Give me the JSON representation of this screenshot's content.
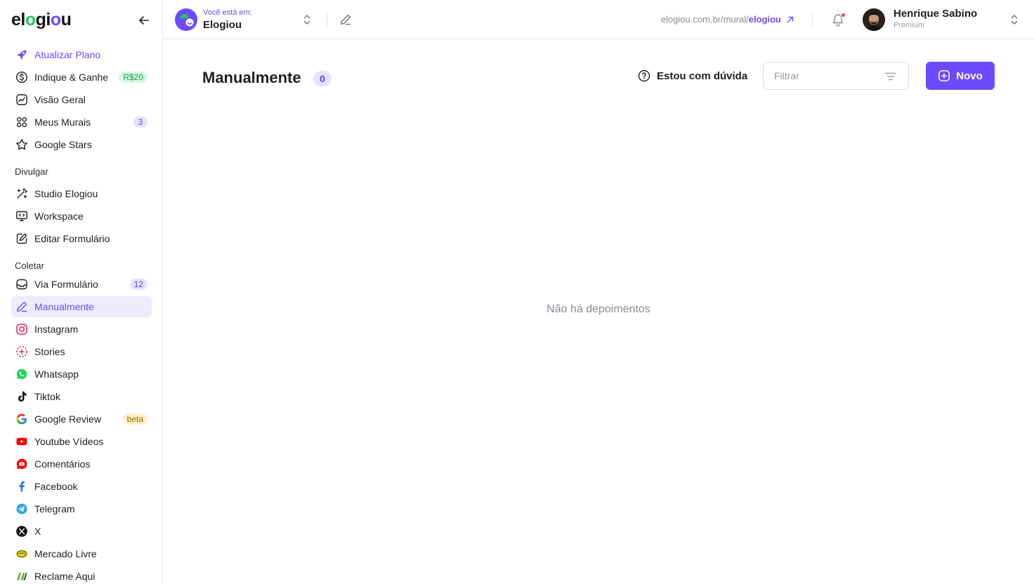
{
  "brand": {
    "logo_text_1": "el",
    "logo_o1": "o",
    "logo_text_2": "gi",
    "logo_o2": "o",
    "logo_text_3": "u",
    "accent": "#6d4aff",
    "green": "#22c55e"
  },
  "sidebar": {
    "top_items": [
      {
        "label": "Atualizar Plano",
        "icon": "rocket-icon"
      },
      {
        "label": "Indique & Ganhe",
        "icon": "dollar-circle-icon",
        "badge": "R$20"
      },
      {
        "label": "Visão Geral",
        "icon": "chart-line-icon"
      },
      {
        "label": "Meus Murais",
        "icon": "grid-icon",
        "badge": "3"
      },
      {
        "label": "Google Stars",
        "icon": "star-icon"
      }
    ],
    "section_divulgar": "Divulgar",
    "divulgar_items": [
      {
        "label": "Studio Elogiou",
        "icon": "magic-wand-icon"
      },
      {
        "label": "Workspace",
        "icon": "monitor-code-icon"
      },
      {
        "label": "Editar Formulário",
        "icon": "edit-square-icon"
      }
    ],
    "section_coletar": "Coletar",
    "coletar_items": [
      {
        "label": "Via Formulário",
        "icon": "inbox-icon",
        "badge": "12"
      },
      {
        "label": "Manualmente",
        "icon": "pencil-icon",
        "active": true
      },
      {
        "label": "Instagram",
        "icon": "instagram-icon"
      },
      {
        "label": "Stories",
        "icon": "stories-icon"
      },
      {
        "label": "Whatsapp",
        "icon": "whatsapp-icon"
      },
      {
        "label": "Tiktok",
        "icon": "tiktok-icon"
      },
      {
        "label": "Google Review",
        "icon": "google-icon",
        "badge": "beta"
      },
      {
        "label": "Youtube Vídeos",
        "icon": "youtube-icon"
      },
      {
        "label": "Comentários",
        "icon": "youtube-comments-icon"
      },
      {
        "label": "Facebook",
        "icon": "facebook-icon"
      },
      {
        "label": "Telegram",
        "icon": "telegram-icon"
      },
      {
        "label": "X",
        "icon": "x-icon"
      },
      {
        "label": "Mercado Livre",
        "icon": "mercado-livre-icon"
      },
      {
        "label": "Reclame Aqui",
        "icon": "reclame-aqui-icon"
      }
    ]
  },
  "topbar": {
    "workspace_kicker": "Você está em:",
    "workspace_name": "Elogiou",
    "mural_url_prefix": "elogiou.com.br/mural/",
    "mural_slug": "elogiou",
    "user_name": "Henrique Sabino",
    "user_plan": "Premium"
  },
  "main": {
    "title": "Manualmente",
    "count": "0",
    "help_label": "Estou com dúvida",
    "filter_placeholder": "Filtrar",
    "filter_value": "",
    "new_label": "Novo",
    "empty_text": "Não há depoimentos"
  }
}
